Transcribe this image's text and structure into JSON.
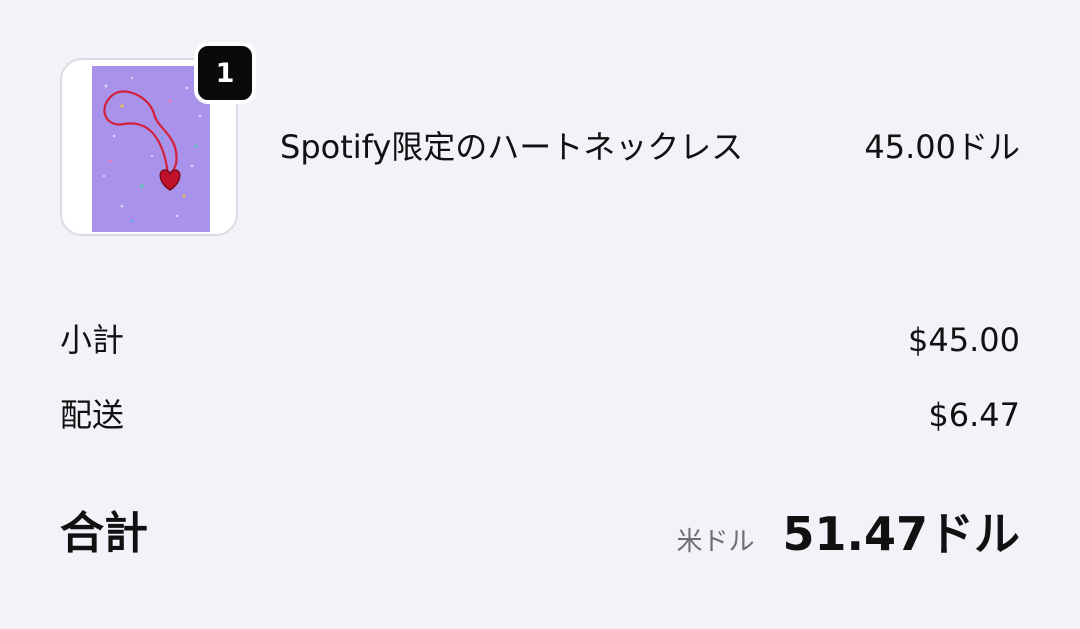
{
  "cart": {
    "item": {
      "image_icon": "heart-necklace-photo",
      "quantity": "1",
      "name": "Spotify限定のハートネックレス",
      "price": "45.00ドル"
    }
  },
  "summary": {
    "subtotal_label": "小計",
    "subtotal_value": "$45.00",
    "shipping_label": "配送",
    "shipping_value": "$6.47"
  },
  "total": {
    "label": "合計",
    "currency": "米ドル",
    "value": "51.47ドル"
  },
  "colors": {
    "background": "#f3f2f8",
    "badge": "#0a0a0a",
    "product_image_bg": "#a993ea",
    "heart": "#c2112b"
  }
}
